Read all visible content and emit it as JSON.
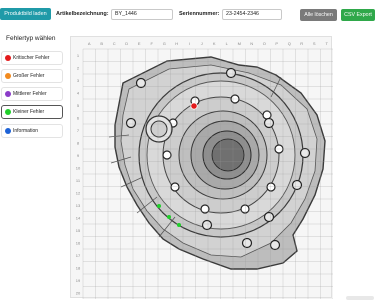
{
  "toolbar": {
    "load_label": "Produktbild laden",
    "article_label": "Artikelbezeichnung:",
    "article_value": "BY_1446",
    "serial_label": "Seriennummer:",
    "serial_value": "23-2454-2346",
    "delete_label": "Alle löschen",
    "export_label": "CSV Export"
  },
  "sidebar": {
    "title": "Fehlertyp wählen",
    "items": [
      {
        "label": "Kritischer Fehler",
        "color": "#e31a1c"
      },
      {
        "label": "Großer Fehler",
        "color": "#f28a1e"
      },
      {
        "label": "Mittlerer Fehler",
        "color": "#8b3cc8"
      },
      {
        "label": "Kleiner Fehler",
        "color": "#1fcf2a",
        "selected": true
      },
      {
        "label": "Information",
        "color": "#1d62d6"
      }
    ]
  },
  "grid": {
    "columns": [
      "A",
      "B",
      "C",
      "D",
      "E",
      "F",
      "G",
      "H",
      "I",
      "J",
      "K",
      "L",
      "M",
      "N",
      "O",
      "P",
      "Q",
      "R",
      "S",
      "T"
    ],
    "rows": [
      "1",
      "2",
      "3",
      "4",
      "5",
      "6",
      "7",
      "8",
      "9",
      "10",
      "11",
      "12",
      "13",
      "14",
      "15",
      "16",
      "17",
      "18",
      "19",
      "20"
    ]
  },
  "markers": [
    {
      "type": "critical",
      "color": "#e31a1c"
    },
    {
      "type": "minor",
      "color": "#1fcf2a"
    },
    {
      "type": "minor",
      "color": "#1fcf2a"
    },
    {
      "type": "minor",
      "color": "#1fcf2a"
    }
  ]
}
